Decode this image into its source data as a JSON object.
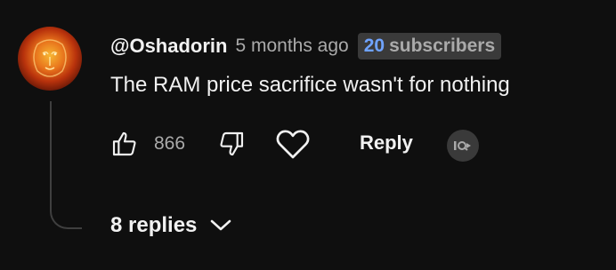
{
  "comment": {
    "author": "@Oshadorin",
    "time": "5 months ago",
    "badge": {
      "count": "20",
      "label": "subscribers"
    },
    "text": "The RAM price sacrifice wasn't for nothing",
    "likes": "866",
    "reply_label": "Reply",
    "replies_label": "8 replies"
  },
  "colors": {
    "background": "#0f0f0f",
    "text_primary": "#f1f1f1",
    "text_secondary": "#aaaaaa",
    "badge_bg": "#3a3a3a",
    "badge_number": "#6fa3ff"
  },
  "icons": {
    "avatar": "lion-flame-avatar",
    "like": "thumbs-up-icon",
    "dislike": "thumbs-down-icon",
    "heart": "heart-icon",
    "creator": "creator-badge-icon",
    "expand": "chevron-down-icon"
  }
}
